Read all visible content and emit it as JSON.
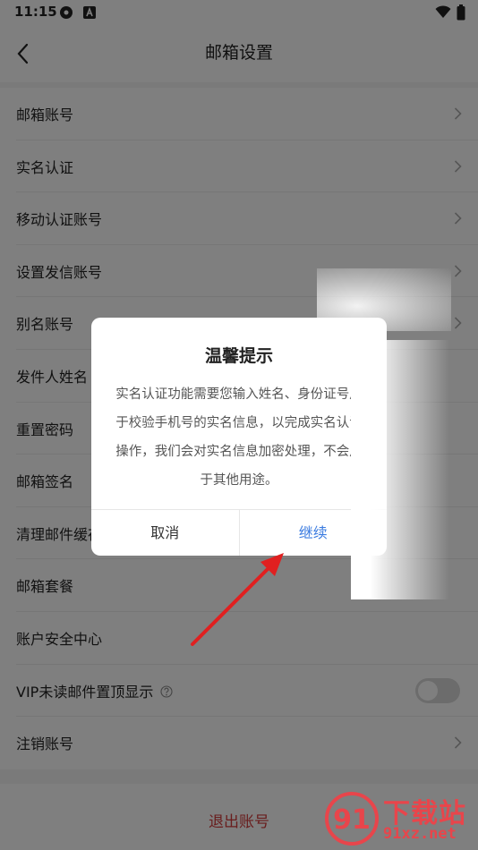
{
  "status_bar": {
    "time": "11:15"
  },
  "header": {
    "title": "邮箱设置"
  },
  "list": {
    "items": [
      {
        "label": "邮箱账号"
      },
      {
        "label": "实名认证"
      },
      {
        "label": "移动认证账号"
      },
      {
        "label": "设置发信账号"
      },
      {
        "label": "别名账号"
      },
      {
        "label": "发件人姓名"
      },
      {
        "label": "重置密码"
      },
      {
        "label": "邮箱签名"
      },
      {
        "label": "清理邮件缓存"
      },
      {
        "label": "邮箱套餐"
      },
      {
        "label": "账户安全中心"
      },
      {
        "label": "VIP未读邮件置顶显示"
      },
      {
        "label": "注销账号"
      }
    ],
    "vip_toggle_on": false
  },
  "logout": {
    "label": "退出账号"
  },
  "dialog": {
    "title": "温馨提示",
    "message": "实名认证功能需要您输入姓名、身份证号用于校验手机号的实名信息，以完成实名认证操作，我们会对实名信息加密处理，不会用于其他用途。",
    "cancel_label": "取消",
    "confirm_label": "继续"
  },
  "watermark": {
    "cn": "下载站",
    "url": "91xz.net",
    "logo_text": "91"
  },
  "colors": {
    "accent": "#3a7be0",
    "danger": "#d23b3b",
    "annotation": "#e02020"
  }
}
